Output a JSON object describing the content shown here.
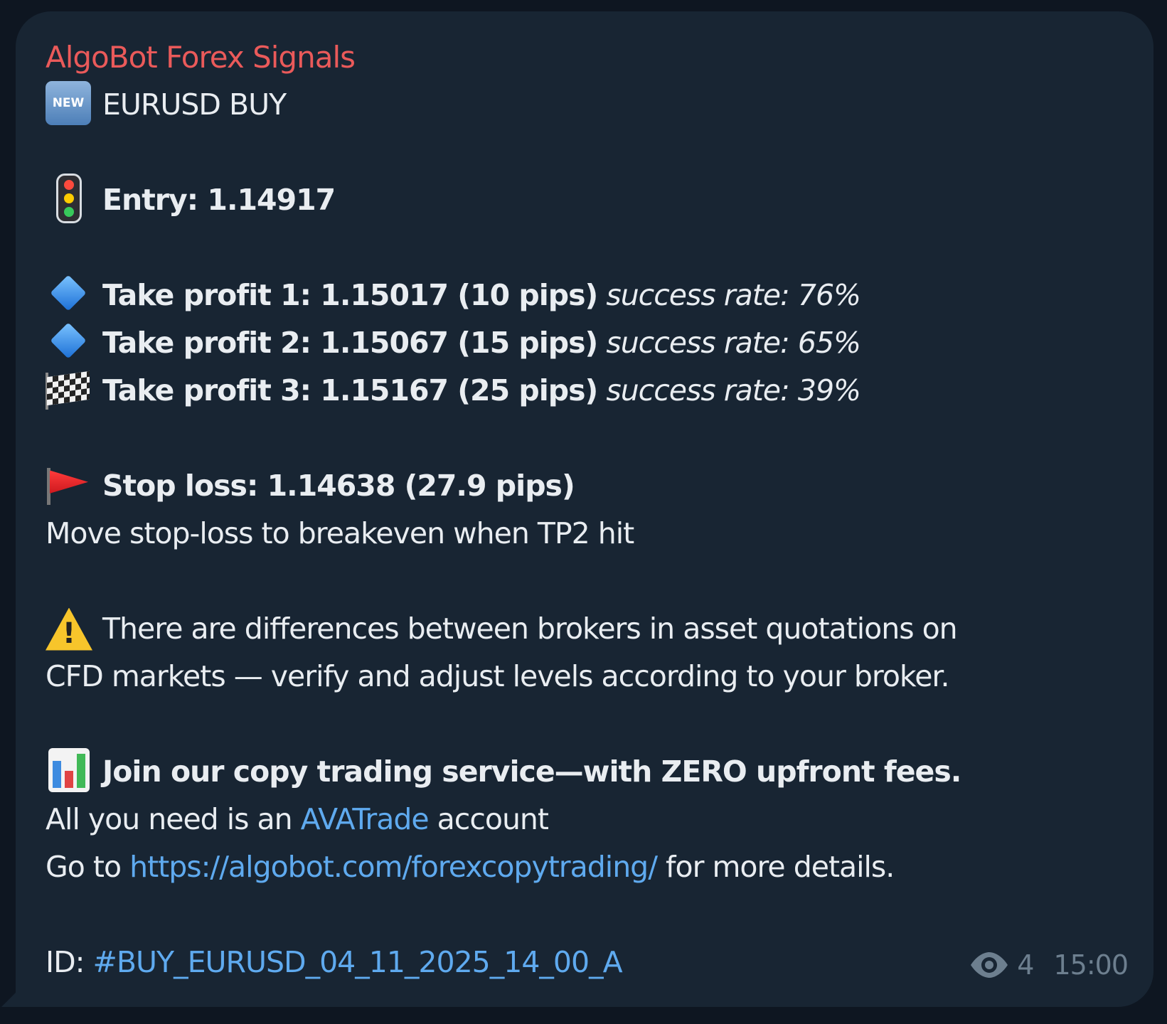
{
  "message": {
    "sender": "AlgoBot Forex Signals",
    "title": "EURUSD BUY",
    "new_badge": "NEW",
    "entry": "Entry: 1.14917",
    "take_profits": [
      {
        "label": "Take profit 1: 1.15017 (10 pips)",
        "rate": "success rate: 76%",
        "icon": "blue-diamond-icon"
      },
      {
        "label": "Take profit 2: 1.15067 (15 pips)",
        "rate": "success rate: 65%",
        "icon": "blue-diamond-icon"
      },
      {
        "label": "Take profit 3: 1.15167 (25 pips)",
        "rate": "success rate: 39%",
        "icon": "chequered-flag-icon"
      }
    ],
    "stop_loss": "Stop loss: 1.14638 (27.9 pips)",
    "breakeven_note": "Move stop-loss to breakeven when TP2 hit",
    "warning_line1": "There are differences between brokers in asset quotations on",
    "warning_line2": "CFD markets — verify and adjust levels according to your broker.",
    "promo_bold": "Join our copy trading service—with ZERO upfront fees.",
    "promo_pre": "All you need is an ",
    "promo_link": "AVATrade",
    "promo_post": " account",
    "goto_pre": "Go to ",
    "goto_link": "https://algobot.com/forexcopytrading/",
    "goto_post": " for more details.",
    "id_label": "ID:",
    "id_hashtag": "#BUY_EURUSD_04_11_2025_14_00_A",
    "views": "4",
    "time": "15:00"
  },
  "colors": {
    "background": "#0e1621",
    "bubble": "#182533",
    "sender": "#ea5a5a",
    "link": "#5faaef",
    "text": "#e9edf1",
    "meta": "#6d7f8f"
  }
}
